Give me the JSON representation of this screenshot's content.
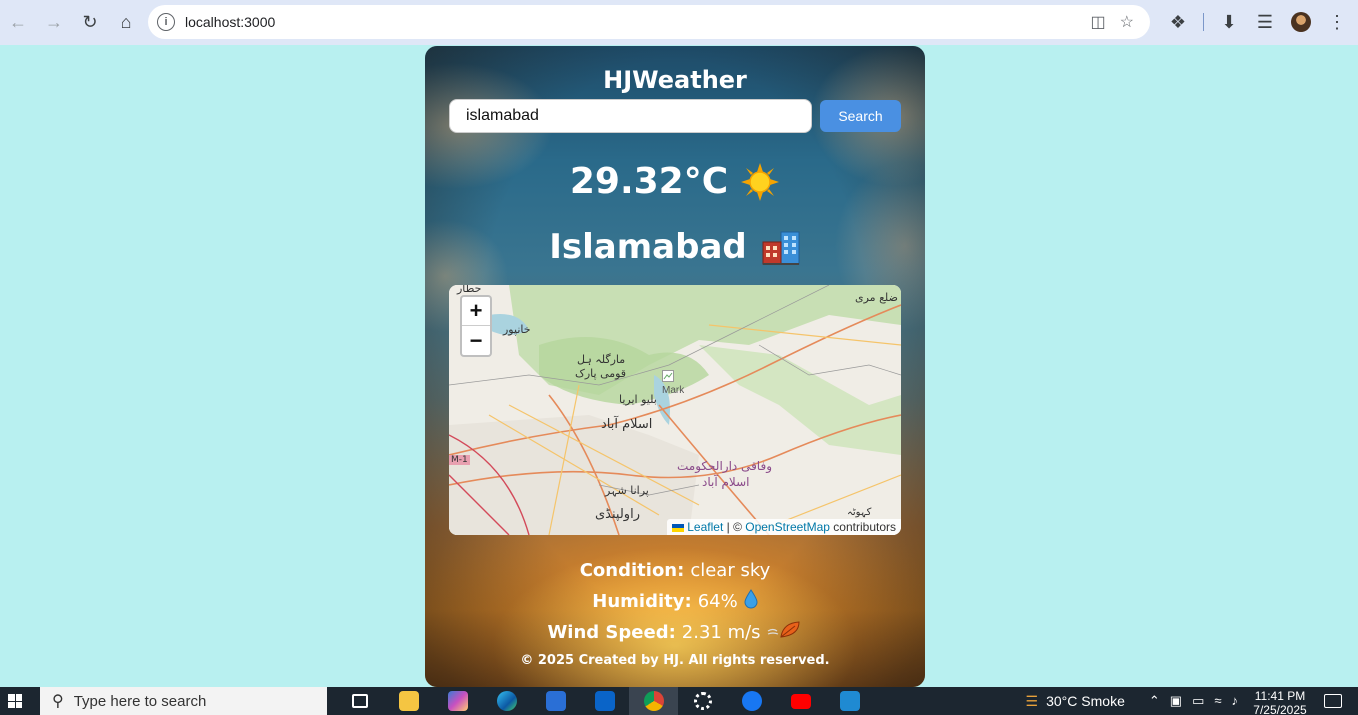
{
  "browser": {
    "url": "localhost:3000",
    "icons": [
      "back-icon",
      "forward-icon",
      "reload-icon",
      "home-icon",
      "site-info-icon",
      "install-app-icon",
      "bookmark-star-icon",
      "extensions-icon",
      "downloads-icon",
      "media-controls-icon",
      "profile-avatar",
      "more-menu-icon"
    ]
  },
  "app": {
    "title": "HJWeather",
    "search": {
      "value": "islamabad",
      "button_label": "Search"
    },
    "temperature": "29.32°C",
    "weather_icon": "sun-icon",
    "city": "Islamabad",
    "city_icon": "city-buildings-icon",
    "map": {
      "zoom_in": "+",
      "zoom_out": "−",
      "marker_alt": "Marker",
      "labels": {
        "hattar": "حطار",
        "khanpur": "خانپور",
        "margalla": "مارگلہ ہل",
        "national_park": "قومی پارک",
        "blue_area": "بلیو ایریا",
        "islamabad": "اسلام آباد",
        "federal_capital": "وفاقی دارالحکومت",
        "federal_capital_2": "اسلام آباد",
        "old_city": "پرانا شہر",
        "rawalpindi": "راولپنڈی",
        "murree": "ضلع مری",
        "m1": "M-1",
        "kahuta": "کہوٹہ"
      },
      "attribution": {
        "leaflet": "Leaflet",
        "separator": " | © ",
        "osm": "OpenStreetMap",
        "suffix": " contributors"
      }
    },
    "details": {
      "condition_label": "Condition:",
      "condition_value": "clear sky",
      "humidity_label": "Humidity:",
      "humidity_value": "64%",
      "wind_label": "Wind Speed:",
      "wind_value": "2.31 m/s"
    },
    "footer": "© 2025 Created by HJ. All rights reserved."
  },
  "taskbar": {
    "search_placeholder": "Type here to search",
    "weather": "30°C  Smoke",
    "time": "11:41 PM",
    "date": "7/25/2025",
    "apps": [
      "task-view-icon",
      "file-explorer-icon",
      "copilot-icon",
      "edge-icon",
      "store-icon",
      "outlook-icon",
      "chrome-icon",
      "settings-icon",
      "facebook-icon",
      "youtube-icon",
      "vscode-icon"
    ]
  }
}
